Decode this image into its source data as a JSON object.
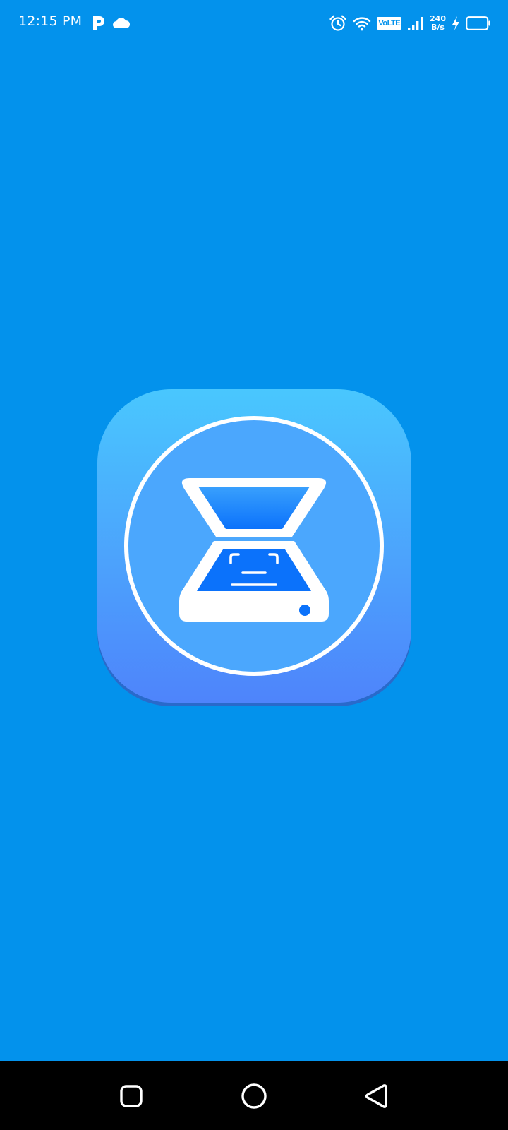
{
  "status_bar": {
    "time": "12:15 PM",
    "left_icons": [
      "parking-app-icon",
      "cloud-icon"
    ],
    "right_icons": [
      "alarm-icon",
      "wifi-icon",
      "volte-icon",
      "signal-icon",
      "charging-bolt-icon",
      "battery-icon"
    ],
    "volte_label": "VoLTE",
    "net_speed_value": "240",
    "net_speed_unit": "B/s"
  },
  "splash": {
    "logo_icon": "document-scanner-icon",
    "background_color": "#0392ec",
    "logo_gradient_top": "#49c7fe",
    "logo_gradient_bottom": "#4e84fb",
    "inner_circle_color": "#4ba7fd"
  },
  "nav_bar": {
    "buttons": [
      "recents-button",
      "home-button",
      "back-button"
    ]
  }
}
